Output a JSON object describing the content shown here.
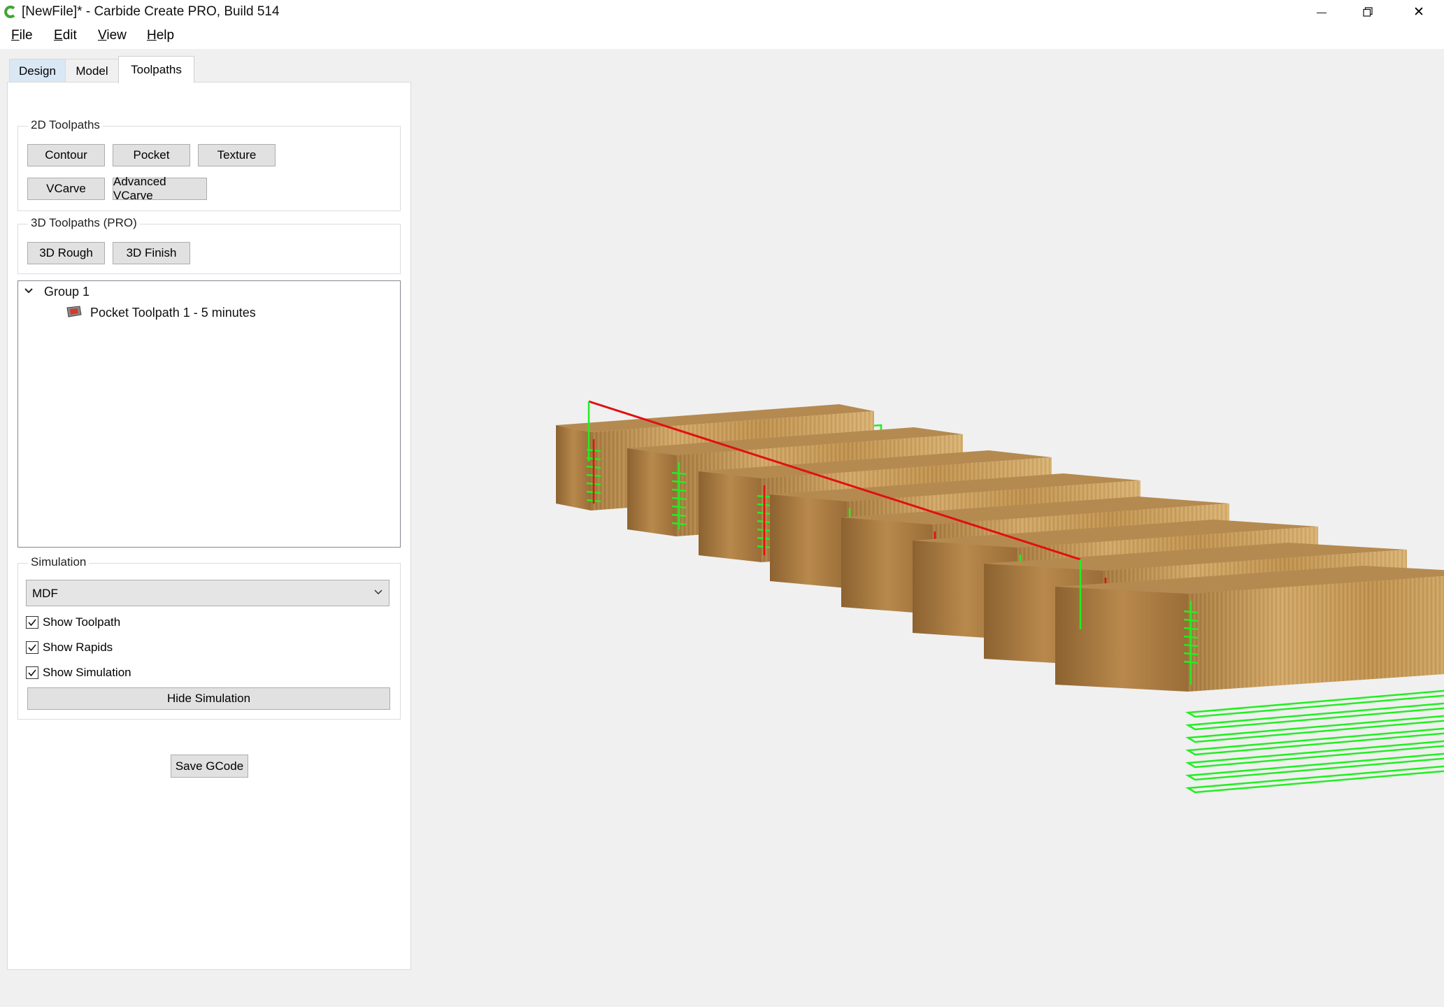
{
  "window": {
    "title": "[NewFile]* - Carbide Create PRO, Build 514",
    "minimize_glyph": "—",
    "close_glyph": "✕"
  },
  "menu": [
    {
      "accel": "F",
      "rest": "ile"
    },
    {
      "accel": "E",
      "rest": "dit"
    },
    {
      "accel": "V",
      "rest": "iew"
    },
    {
      "accel": "H",
      "rest": "elp"
    }
  ],
  "tabs": [
    "Design",
    "Model",
    "Toolpaths"
  ],
  "active_tab": "Toolpaths",
  "toolpaths_2d": {
    "title": "2D Toolpaths",
    "buttons": [
      "Contour",
      "Pocket",
      "Texture",
      "VCarve",
      "Advanced VCarve"
    ]
  },
  "toolpaths_3d": {
    "title": "3D Toolpaths (PRO)",
    "buttons": [
      "3D Rough",
      "3D Finish"
    ]
  },
  "tree": {
    "group_label": "Group 1",
    "item_label": "Pocket Toolpath 1 - 5 minutes",
    "expanded": true
  },
  "simulation": {
    "title": "Simulation",
    "material": "MDF",
    "checkboxes": [
      {
        "label": "Show Toolpath",
        "checked": true
      },
      {
        "label": "Show Rapids",
        "checked": true
      },
      {
        "label": "Show Simulation",
        "checked": true
      }
    ],
    "hide_button": "Hide Simulation"
  },
  "save_gcode": "Save GCode",
  "colors": {
    "toolpath": "#22ee22",
    "rapid": "#e01010",
    "wood_top": "#b58a50",
    "wood_front": "#c99e5e",
    "tab_first": "#dae8f5",
    "app_icon": "#3fa535"
  }
}
